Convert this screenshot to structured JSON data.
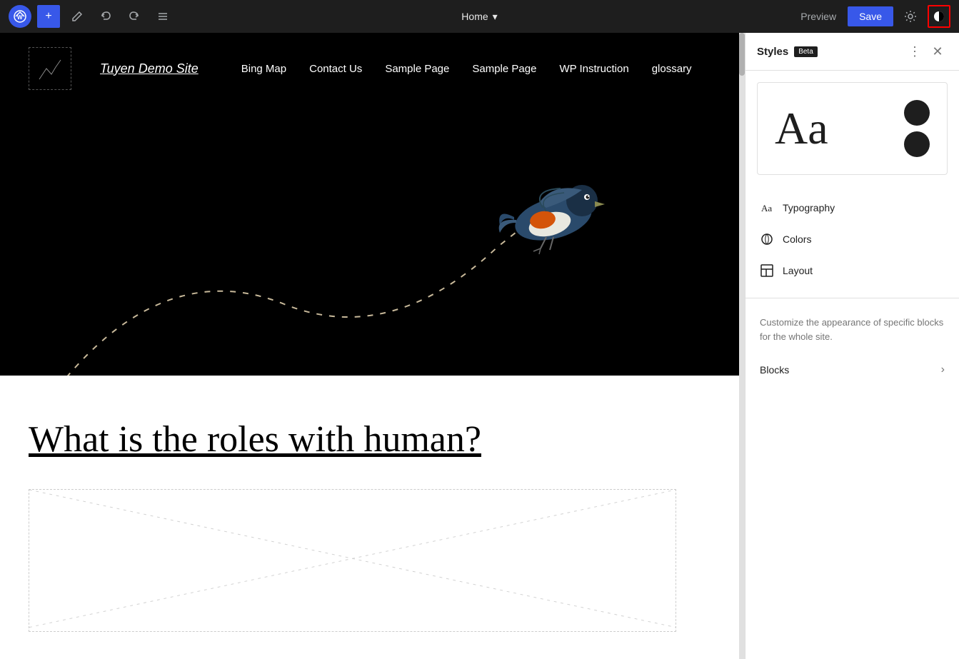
{
  "toolbar": {
    "wp_logo": "W",
    "add_label": "+",
    "edit_icon": "✏",
    "undo_icon": "↩",
    "redo_icon": "↪",
    "list_icon": "≡",
    "home_label": "Home",
    "chevron_down": "▾",
    "preview_label": "Preview",
    "save_label": "Save",
    "gear_icon": "⚙",
    "styles_icon": "◑",
    "more_icon": "⋮",
    "close_icon": "✕"
  },
  "site": {
    "logo_alt": "site logo",
    "title": "Tuyen Demo Site",
    "nav": [
      {
        "label": "Bing Map"
      },
      {
        "label": "Contact Us"
      },
      {
        "label": "Sample Page"
      },
      {
        "label": "Sample Page"
      },
      {
        "label": "WP Instruction"
      },
      {
        "label": "glossary"
      }
    ],
    "heading": "What is the roles with human?"
  },
  "styles_panel": {
    "title": "Styles",
    "beta_label": "Beta",
    "preview_text": "Aa",
    "items": [
      {
        "id": "typography",
        "label": "Typography",
        "icon": "typography"
      },
      {
        "id": "colors",
        "label": "Colors",
        "icon": "colors"
      },
      {
        "id": "layout",
        "label": "Layout",
        "icon": "layout"
      }
    ],
    "description": "Customize the appearance of specific blocks for the whole site.",
    "blocks_label": "Blocks",
    "chevron_right": "›"
  }
}
